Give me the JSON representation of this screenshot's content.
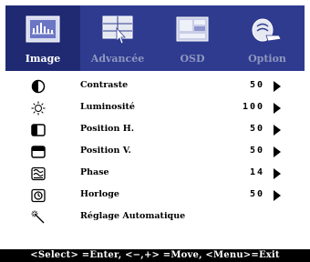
{
  "tabs": [
    {
      "label": "Image",
      "icon": "image-tab-icon",
      "active": true
    },
    {
      "label": "Advancée",
      "icon": "advanced-tab-icon",
      "active": false
    },
    {
      "label": "OSD",
      "icon": "osd-tab-icon",
      "active": false
    },
    {
      "label": "Option",
      "icon": "option-tab-icon",
      "active": false
    }
  ],
  "items": [
    {
      "label": "Contraste",
      "value": "50",
      "icon": "contrast-icon"
    },
    {
      "label": "Luminosité",
      "value": "100",
      "icon": "brightness-icon"
    },
    {
      "label": "Position H.",
      "value": "50",
      "icon": "h-position-icon"
    },
    {
      "label": "Position V.",
      "value": "50",
      "icon": "v-position-icon"
    },
    {
      "label": "Phase",
      "value": "14",
      "icon": "phase-icon"
    },
    {
      "label": "Horloge",
      "value": "50",
      "icon": "clock-icon"
    },
    {
      "label": "Réglage Automatique",
      "value": "",
      "icon": "auto-adjust-icon"
    }
  ],
  "footer": {
    "hint": "<Select> =Enter, <−,+> =Move, <Menu>=Exit"
  },
  "colors": {
    "tab_bar": "#2e3b8f",
    "tab_active": "#1f2a73",
    "footer_bg": "#000000"
  }
}
